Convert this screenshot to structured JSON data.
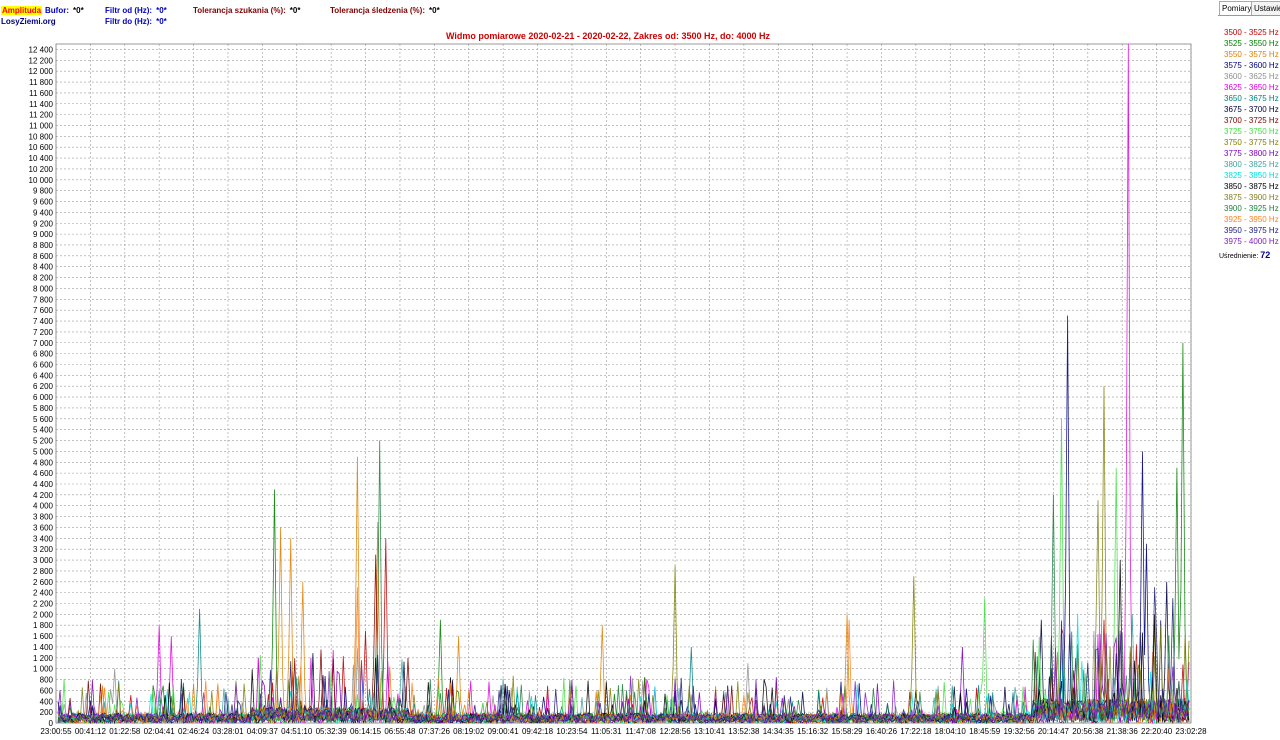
{
  "header": {
    "badge": "Amplituda",
    "site": "LosyZiemi.org",
    "buffer_label": "Bufor:",
    "buffer_value": "*0*",
    "filter_from_label": "Filtr od (Hz):",
    "filter_from_value": "*0*",
    "filter_to_label": "Filtr do (Hz):",
    "filter_to_value": "*0*",
    "tol_search_label": "Tolerancja szukania (%):",
    "tol_search_value": "*0*",
    "tol_track_label": "Tolerancja śledzenia (%):",
    "tol_track_value": "*0*"
  },
  "tabs": [
    "Pomiary",
    "Ustawie"
  ],
  "average": {
    "label": "Uśrednienie:",
    "value": "72"
  },
  "chart_data": {
    "type": "line",
    "title": "Widmo pomiarowe 2020-02-21 - 2020-02-22, Zakres od: 3500 Hz, do: 4000 Hz",
    "ylim": [
      0,
      12500
    ],
    "y_ticks": [
      "0",
      "200",
      "400",
      "600",
      "800",
      "1 000",
      "1 200",
      "1 400",
      "1 600",
      "1 800",
      "2 000",
      "2 200",
      "2 400",
      "2 600",
      "2 800",
      "3 000",
      "3 200",
      "3 400",
      "3 600",
      "3 800",
      "4 000",
      "4 200",
      "4 400",
      "4 600",
      "4 800",
      "5 000",
      "5 200",
      "5 400",
      "5 600",
      "5 800",
      "6 000",
      "6 200",
      "6 400",
      "6 600",
      "6 800",
      "7 000",
      "7 200",
      "7 400",
      "7 600",
      "7 800",
      "8 000",
      "8 200",
      "8 400",
      "8 600",
      "8 800",
      "9 000",
      "9 200",
      "9 400",
      "9 600",
      "9 800",
      "10 000",
      "10 200",
      "10 400",
      "10 600",
      "10 800",
      "11 000",
      "11 200",
      "11 400",
      "11 600",
      "11 800",
      "12 000",
      "12 200",
      "12 400"
    ],
    "x_ticks": [
      "23:00:55",
      "00:41:12",
      "01:22:58",
      "02:04:41",
      "02:46:24",
      "03:28:01",
      "04:09:37",
      "04:51:10",
      "05:32:39",
      "06:14:15",
      "06:55:48",
      "07:37:26",
      "08:19:02",
      "09:00:41",
      "09:42:18",
      "10:23:54",
      "11:05:31",
      "11:47:08",
      "12:28:56",
      "13:10:41",
      "13:52:38",
      "14:34:35",
      "15:16:32",
      "15:58:29",
      "16:40:26",
      "17:22:18",
      "18:04:10",
      "18:45:59",
      "19:32:56",
      "20:14:47",
      "20:56:38",
      "21:38:36",
      "22:20:40",
      "23:02:28"
    ],
    "grid": true,
    "legend_position": "right",
    "series": [
      {
        "name": "3500 - 3525 Hz",
        "color": "#c00000",
        "peaks": [
          [
            0.272,
            1700
          ],
          [
            0.29,
            3400
          ],
          [
            0.925,
            1900
          ]
        ]
      },
      {
        "name": "3525 - 3550 Hz",
        "color": "#008000",
        "peaks": [
          [
            0.192,
            4300
          ],
          [
            0.338,
            1900
          ],
          [
            0.995,
            7000
          ],
          [
            0.99,
            4700
          ]
        ]
      },
      {
        "name": "3550 - 3575 Hz",
        "color": "#e08000",
        "peaks": [
          [
            0.196,
            3600
          ],
          [
            0.205,
            3400
          ],
          [
            0.217,
            2600
          ],
          [
            0.264,
            4900
          ],
          [
            0.282,
            3700
          ],
          [
            0.697,
            2000
          ],
          [
            0.355,
            1600
          ],
          [
            0.481,
            1800
          ]
        ]
      },
      {
        "name": "3575 - 3600 Hz",
        "color": "#000080",
        "peaks": [
          [
            0.893,
            7500
          ],
          [
            0.958,
            5000
          ],
          [
            0.963,
            3300
          ]
        ]
      },
      {
        "name": "3600 - 3625 Hz",
        "color": "#909090",
        "peaks": [
          [
            0.05,
            1000
          ],
          [
            0.61,
            1100
          ]
        ]
      },
      {
        "name": "3625 - 3650 Hz",
        "color": "#e000e0",
        "peaks": [
          [
            0.946,
            12500
          ],
          [
            0.09,
            1800
          ],
          [
            0.1,
            1600
          ]
        ]
      },
      {
        "name": "3650 - 3675 Hz",
        "color": "#008080",
        "peaks": [
          [
            0.126,
            2100
          ],
          [
            0.56,
            1400
          ]
        ]
      },
      {
        "name": "3675 - 3700 Hz",
        "color": "#000040",
        "peaks": [
          [
            0.87,
            1900
          ],
          [
            0.98,
            2600
          ]
        ]
      },
      {
        "name": "3700 - 3725 Hz",
        "color": "#800000",
        "peaks": [
          [
            0.28,
            3100
          ],
          [
            0.31,
            1200
          ]
        ]
      },
      {
        "name": "3725 - 3750 Hz",
        "color": "#40e040",
        "peaks": [
          [
            0.888,
            5600
          ],
          [
            0.935,
            4700
          ],
          [
            0.82,
            2300
          ]
        ]
      },
      {
        "name": "3750 - 3775 Hz",
        "color": "#808000",
        "peaks": [
          [
            0.925,
            6200
          ],
          [
            0.545,
            2900
          ],
          [
            0.756,
            2700
          ]
        ]
      },
      {
        "name": "3775 - 3800 Hz",
        "color": "#8000c0",
        "peaks": [
          [
            0.8,
            1400
          ],
          [
            0.9,
            1200
          ]
        ]
      },
      {
        "name": "3800 - 3825 Hz",
        "color": "#40a0a0",
        "peaks": [
          [
            0.95,
            2000
          ]
        ]
      },
      {
        "name": "3825 - 3850 Hz",
        "color": "#00e0e0",
        "peaks": [
          [
            0.998,
            800
          ]
        ]
      },
      {
        "name": "3850 - 3875 Hz",
        "color": "#000000",
        "peaks": [
          [
            0.94,
            3000
          ],
          [
            0.97,
            2000
          ]
        ]
      },
      {
        "name": "3875 - 3900 Hz",
        "color": "#808020",
        "peaks": [
          [
            0.92,
            4100
          ]
        ]
      },
      {
        "name": "3900 - 3925 Hz",
        "color": "#208040",
        "peaks": [
          [
            0.285,
            5200
          ],
          [
            0.88,
            4200
          ]
        ]
      },
      {
        "name": "3925 - 3950 Hz",
        "color": "#ff8020",
        "peaks": [
          [
            0.265,
            2500
          ],
          [
            0.7,
            1900
          ]
        ]
      },
      {
        "name": "3950 - 3975 Hz",
        "color": "#202080",
        "peaks": [
          [
            0.97,
            2500
          ],
          [
            0.985,
            2300
          ]
        ]
      },
      {
        "name": "3975 - 4000 Hz",
        "color": "#8020c0",
        "peaks": [
          [
            0.94,
            1700
          ]
        ]
      }
    ]
  }
}
